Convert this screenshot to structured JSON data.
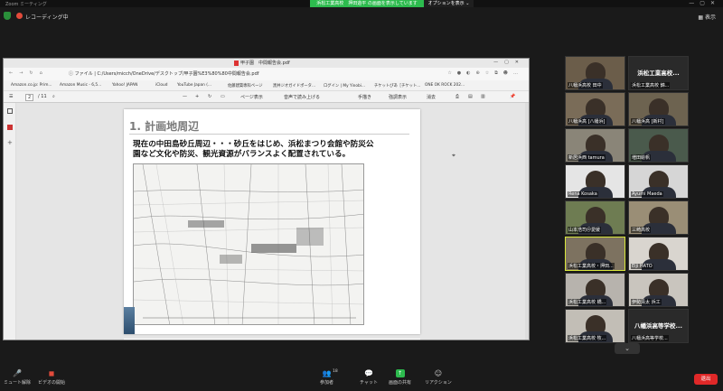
{
  "zoom": {
    "window_title": "Zoom ミーティング",
    "share_banner": "浜松工業高校　押田遊平 の画面を表示しています",
    "share_options": "オプションを表示 ⌄",
    "recording": "レコーディング中",
    "view": "表示"
  },
  "browser": {
    "tab_title": "甲子園　中間報告会.pdf",
    "address_prefix": "ファイル",
    "url": "C:/Users/micch/OneDrive/デスクトップ/甲子園%E3%80%80中間報告会.pdf",
    "bookmarks": [
      "Amazon.co.jp: Prim...",
      "Amazon Music - 6,5...",
      "Yahoo! JAPAN",
      "iCloud",
      "YouTube Japan (...",
      "佐藤建築専科ページ",
      "黒井ジオガイドポータ...",
      "ログイン | My Yinobi...",
      "チケットぴあ［チケット...",
      "ONE OK ROCK 202..."
    ],
    "pdf_toolbar": {
      "page_current": "2",
      "page_total": "/ 11",
      "zoom_minus": "—",
      "zoom_plus": "+",
      "page_view": "ページ表示",
      "read_aloud": "音声で読み上げる",
      "draw": "手描き",
      "highlight": "強調表示",
      "erase": "消去"
    }
  },
  "pdf_page": {
    "heading": "1. 計画地周辺",
    "body_line1": "現在の中田島砂丘周辺・・・砂丘をはじめ、浜松まつり会館や防災公",
    "body_line2": "園など文化や防災、観光資源がバランスよく配置されている。"
  },
  "participants": [
    {
      "name": "八幡浜高校 田中",
      "label": "",
      "video": true
    },
    {
      "name": "浜松工業高校 錦...",
      "label": "浜松工業高校...",
      "video": false
    },
    {
      "name": "八幡浜高 [八幡浜]",
      "label": "",
      "video": true
    },
    {
      "name": "八幡浜高 [新村]",
      "label": "",
      "video": true
    },
    {
      "name": "新居浜西 tamura",
      "label": "",
      "video": true
    },
    {
      "name": "増田絵帆",
      "label": "",
      "video": true
    },
    {
      "name": "Rena Kosaka",
      "label": "",
      "video": true
    },
    {
      "name": "Ayumi Maeda",
      "label": "",
      "video": true
    },
    {
      "name": "山本浩司＠愛媛",
      "label": "",
      "video": true
    },
    {
      "name": "三崎高校",
      "label": "",
      "video": true
    },
    {
      "name": "浜松工業高校・押田...",
      "label": "",
      "video": true
    },
    {
      "name": "Eiji HATO",
      "label": "",
      "video": true
    },
    {
      "name": "浜松工業高校 橋...",
      "label": "",
      "video": true
    },
    {
      "name": "伊勢清太 浜工",
      "label": "",
      "video": true
    },
    {
      "name": "浜松工業高校 牧...",
      "label": "",
      "video": true
    },
    {
      "name": "八幡浜高等学校...",
      "label": "八幡浜高等学校...",
      "video": false
    }
  ],
  "controls": {
    "mute": "ミュート解除",
    "video": "ビデオの開始",
    "participants": "参加者",
    "participants_count": "18",
    "chat": "チャット",
    "share": "画面の共有",
    "reactions": "リアクション",
    "leave": "退出"
  },
  "colors": {
    "share_green": "#2dbb4e",
    "leave_red": "#e02828",
    "active_speaker": "#d8e63b"
  }
}
